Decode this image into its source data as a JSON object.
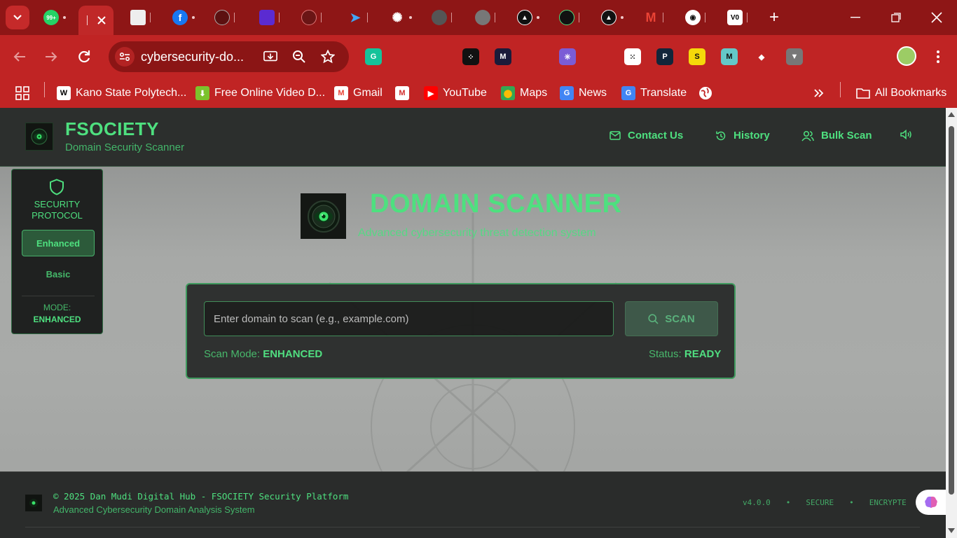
{
  "browser": {
    "tabs": [
      {
        "name": "whatsapp",
        "badge": "99+",
        "color": "#25d366"
      },
      {
        "name": "active",
        "color": "#c02828"
      },
      {
        "name": "tab-doc",
        "color": "#e8e8e8"
      },
      {
        "name": "facebook",
        "color": "#1877f2"
      },
      {
        "name": "tab-circle",
        "color": "#5c1010"
      },
      {
        "name": "tab-purple",
        "color": "#5b2bd1"
      },
      {
        "name": "tab-compass",
        "color": "#6a1515"
      },
      {
        "name": "tab-arrow",
        "color": "#1e88e5"
      },
      {
        "name": "chatgpt",
        "color": "#ffffff"
      },
      {
        "name": "tab-gemini",
        "color": "#555"
      },
      {
        "name": "tab-globe",
        "color": "#777"
      },
      {
        "name": "tab-triangle-1",
        "color": "#111"
      },
      {
        "name": "tab-eye",
        "color": "#111"
      },
      {
        "name": "tab-triangle-2",
        "color": "#111"
      },
      {
        "name": "gmail",
        "color": "#ea4335"
      },
      {
        "name": "github",
        "color": "#fff"
      },
      {
        "name": "tab-v0",
        "color": "#fff"
      }
    ],
    "address": "cybersecurity-do...",
    "extensions": [
      {
        "name": "grammarly",
        "color": "#15c39a",
        "label": "G"
      },
      {
        "name": "robot",
        "color": "#c02424",
        "label": ""
      },
      {
        "name": "gift",
        "color": "#c02424",
        "label": ""
      },
      {
        "name": "dots",
        "color": "#111",
        "label": "⁘"
      },
      {
        "name": "me",
        "color": "#1b1b3a",
        "label": "M"
      },
      {
        "name": "metamask",
        "color": "#c02424",
        "label": ""
      },
      {
        "name": "asterisk",
        "color": "#7b5cd6",
        "label": "✳"
      },
      {
        "name": "wave",
        "color": "#c02424",
        "label": ""
      },
      {
        "name": "grid",
        "color": "#fff",
        "label": "⁙"
      },
      {
        "name": "p-ext",
        "color": "#12263a",
        "label": "P"
      },
      {
        "name": "s-ext",
        "color": "#f5d90a",
        "label": "S"
      },
      {
        "name": "m-ext",
        "color": "#64c8c8",
        "label": "M"
      },
      {
        "name": "diamond",
        "color": "#c02424",
        "label": "◆"
      },
      {
        "name": "download",
        "color": "#777",
        "label": "▼"
      },
      {
        "name": "brain",
        "color": "#c02424",
        "label": ""
      },
      {
        "name": "puzzle",
        "color": "#c02424",
        "label": ""
      }
    ],
    "bookmarks": [
      {
        "label": "Kano State Polytech...",
        "icon": "W",
        "color": "#fff",
        "fg": "#000"
      },
      {
        "label": "Free Online Video D...",
        "icon": "⬇",
        "color": "#7cc22c",
        "fg": "#fff"
      },
      {
        "label": "Gmail",
        "icon": "M",
        "color": "#fff",
        "fg": "#ea4335"
      },
      {
        "label": "",
        "icon": "M",
        "color": "#fff",
        "fg": "#d32f2f"
      },
      {
        "label": "YouTube",
        "icon": "▶",
        "color": "#ff0000",
        "fg": "#fff"
      },
      {
        "label": "Maps",
        "icon": "⬤",
        "color": "#34a853",
        "fg": "#fbbc04"
      },
      {
        "label": "News",
        "icon": "G",
        "color": "#4285f4",
        "fg": "#fff"
      },
      {
        "label": "Translate",
        "icon": "G",
        "color": "#4285f4",
        "fg": "#fff"
      }
    ],
    "all_bookmarks": "All Bookmarks"
  },
  "header": {
    "brand": "FSOCIETY",
    "subtitle": "Domain Security Scanner",
    "nav": {
      "contact": "Contact Us",
      "history": "History",
      "bulk": "Bulk Scan"
    }
  },
  "sidebar": {
    "title": "SECURITY PROTOCOL",
    "enhanced": "Enhanced",
    "basic": "Basic",
    "mode_label": "MODE:",
    "mode_value": "ENHANCED"
  },
  "hero": {
    "title": "DOMAIN SCANNER",
    "subtitle": "Advanced cybersecurity threat detection system"
  },
  "scan": {
    "placeholder": "Enter domain to scan (e.g., example.com)",
    "button": "SCAN",
    "mode_label": "Scan Mode:",
    "mode_value": "ENHANCED",
    "status_label": "Status:",
    "status_value": "READY"
  },
  "footer": {
    "copyright": "© 2025 Dan Mudi Digital Hub - FSOCIETY Security Platform",
    "subtitle": "Advanced Cybersecurity Domain Analysis System",
    "version": "v4.0.0",
    "secure": "SECURE",
    "encrypted": "ENCRYPTE"
  },
  "colors": {
    "accent": "#4ee07f",
    "chrome_red": "#c02424",
    "chrome_dark_red": "#8e1616"
  }
}
